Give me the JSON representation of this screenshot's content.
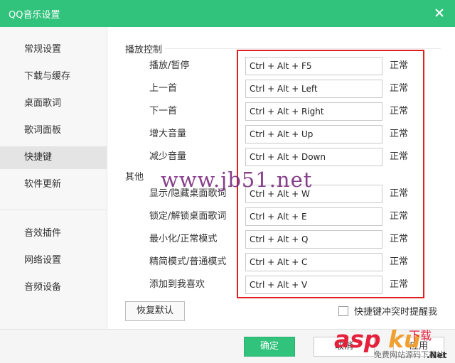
{
  "window": {
    "title": "QQ音乐设置"
  },
  "sidebar": {
    "items": [
      {
        "label": "常规设置"
      },
      {
        "label": "下载与缓存"
      },
      {
        "label": "桌面歌词"
      },
      {
        "label": "歌词面板"
      },
      {
        "label": "快捷键",
        "active": true
      },
      {
        "label": "软件更新"
      },
      {
        "label": "音效插件"
      },
      {
        "label": "网络设置"
      },
      {
        "label": "音频设备"
      }
    ]
  },
  "sections": {
    "playback": "播放控制",
    "other": "其他"
  },
  "shortcuts": [
    {
      "label": "播放/暂停",
      "keys": "Ctrl + Alt + F5",
      "status": "正常"
    },
    {
      "label": "上一首",
      "keys": "Ctrl + Alt + Left",
      "status": "正常"
    },
    {
      "label": "下一首",
      "keys": "Ctrl + Alt + Right",
      "status": "正常"
    },
    {
      "label": "增大音量",
      "keys": "Ctrl + Alt + Up",
      "status": "正常"
    },
    {
      "label": "减少音量",
      "keys": "Ctrl + Alt + Down",
      "status": "正常"
    },
    {
      "label": "显示/隐藏桌面歌词",
      "keys": "Ctrl + Alt + W",
      "status": "正常"
    },
    {
      "label": "锁定/解锁桌面歌词",
      "keys": "Ctrl + Alt + E",
      "status": "正常"
    },
    {
      "label": "最小化/正常模式",
      "keys": "Ctrl + Alt + Q",
      "status": "正常"
    },
    {
      "label": "精简模式/普通模式",
      "keys": "Ctrl + Alt + C",
      "status": "正常"
    },
    {
      "label": "添加到我喜欢",
      "keys": "Ctrl + Alt + V",
      "status": "正常"
    }
  ],
  "buttons": {
    "reset": "恢复默认",
    "ok": "确定",
    "cancel": "取消",
    "apply": "应用"
  },
  "conflict_reminder": {
    "label": "快捷键冲突时提醒我",
    "checked": false
  },
  "overlays": {
    "watermark": "www.jb51.net",
    "logo": "asp",
    "logo_ku": "ku",
    "logo_sub": "下载",
    "logo_small": "免费网站源码下载站",
    "logo_net": ".Net"
  },
  "colors": {
    "accent": "#31c27c",
    "highlight_box": "#e02020"
  }
}
